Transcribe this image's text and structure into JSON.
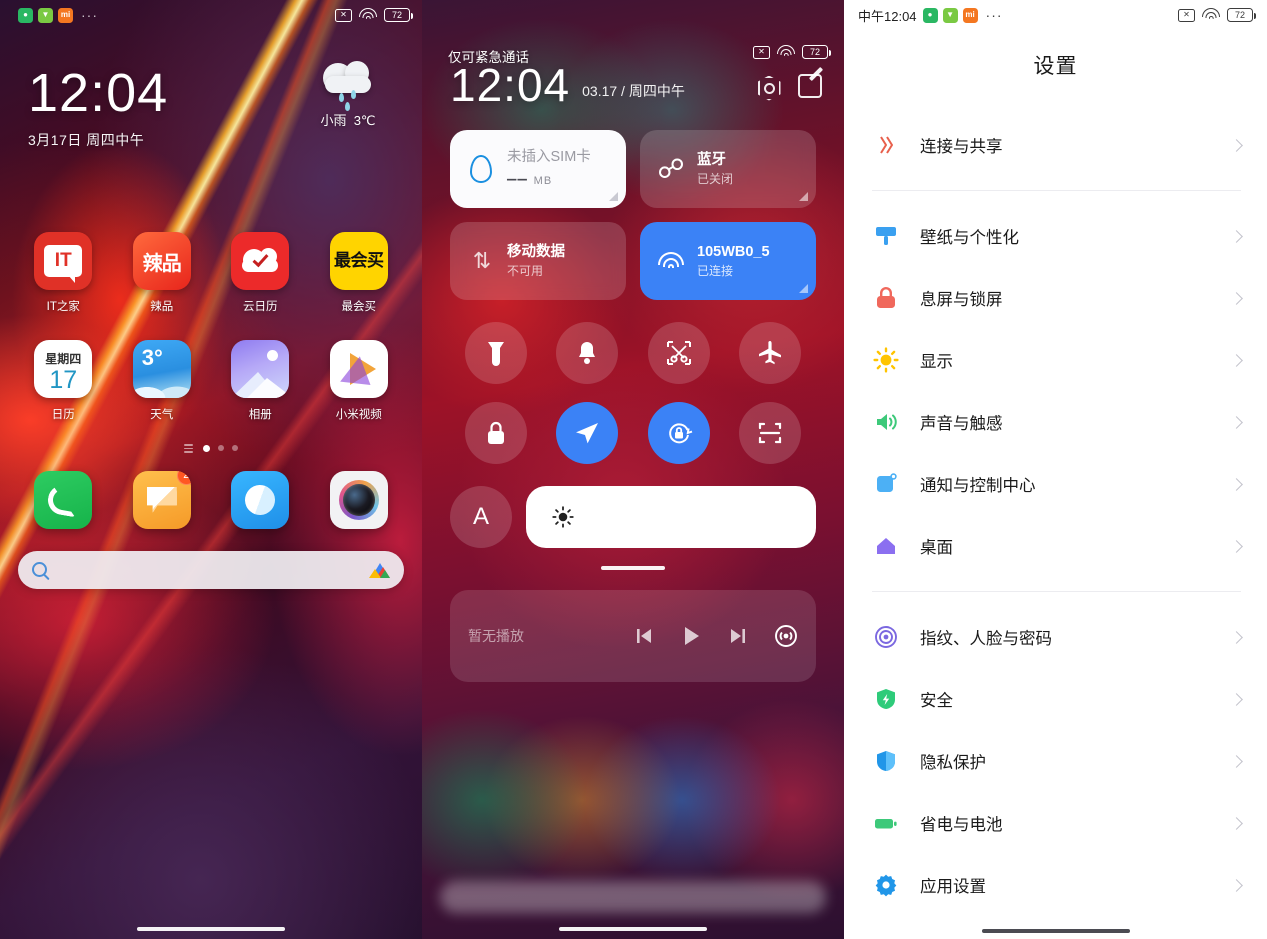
{
  "home": {
    "statusbar": {
      "app_icons": [
        "wechat-mini-icon",
        "alipay-mini-icon",
        "mi-mini-icon"
      ],
      "overflow": "···",
      "sim": "✕",
      "battery": "72"
    },
    "clock": {
      "time": "12:04",
      "date": "3月17日 周四中午"
    },
    "weather": {
      "condition": "小雨",
      "temperature": "3℃",
      "icon": "rain-cloud-icon"
    },
    "apps": [
      {
        "label": "IT之家",
        "icon": "ithome-icon"
      },
      {
        "label": "辣品",
        "icon": "lapin-icon",
        "glyph": "辣品"
      },
      {
        "label": "云日历",
        "icon": "cloud-calendar-icon"
      },
      {
        "label": "最会买",
        "icon": "zuihuimai-icon",
        "glyph_top": "最会买"
      },
      {
        "label": "日历",
        "icon": "calendar-icon",
        "weekday": "星期四",
        "day": "17"
      },
      {
        "label": "天气",
        "icon": "weather-icon",
        "temp": "3°"
      },
      {
        "label": "相册",
        "icon": "gallery-icon"
      },
      {
        "label": "小米视频",
        "icon": "mi-video-icon"
      }
    ],
    "page_dots": {
      "total": 3,
      "active_index": 0
    },
    "dock": [
      {
        "label": "phone",
        "icon": "phone-icon"
      },
      {
        "label": "messages",
        "icon": "message-icon",
        "badge": "2"
      },
      {
        "label": "browser",
        "icon": "browser-icon"
      },
      {
        "label": "camera",
        "icon": "camera-icon"
      }
    ],
    "search": {
      "placeholder": "",
      "icon": "search-icon",
      "lens_icon": "google-lens-icon"
    }
  },
  "control_center": {
    "status_text": "仅可紧急通话",
    "statusbar": {
      "sim": "✕",
      "battery": "72"
    },
    "clock": {
      "time": "12:04",
      "date": "03.17 / 周四中午"
    },
    "header_icons": [
      {
        "name": "settings-hex-icon"
      },
      {
        "name": "edit-icon"
      }
    ],
    "tiles": [
      {
        "title": "未插入SIM卡",
        "subtitle": "‒‒",
        "unit": "MB",
        "icon": "data-drop-icon",
        "state": "light"
      },
      {
        "title": "蓝牙",
        "subtitle": "已关闭",
        "icon": "bluetooth-icon",
        "state": "glass"
      },
      {
        "title": "移动数据",
        "subtitle": "不可用",
        "icon": "mobile-data-icon",
        "state": "glass"
      },
      {
        "title": "105WB0_5",
        "subtitle": "已连接",
        "icon": "wifi-icon",
        "state": "blue"
      }
    ],
    "toggles": [
      {
        "name": "flashlight-icon",
        "active": false
      },
      {
        "name": "bell-icon",
        "active": false
      },
      {
        "name": "screenshot-icon",
        "active": false
      },
      {
        "name": "airplane-mode-icon",
        "active": false
      },
      {
        "name": "lock-icon",
        "active": false
      },
      {
        "name": "location-icon",
        "active": true
      },
      {
        "name": "rotation-lock-icon",
        "active": true
      },
      {
        "name": "scan-icon",
        "active": false
      }
    ],
    "brightness": {
      "auto_label": "A",
      "icon": "sun-icon",
      "level": 0
    },
    "media": {
      "label": "暂无播放",
      "controls": [
        "prev-icon",
        "play-icon",
        "next-icon",
        "cast-icon"
      ]
    }
  },
  "settings": {
    "statusbar": {
      "time": "中午12:04",
      "overflow": "···",
      "sim": "✕",
      "battery": "72"
    },
    "title": "设置",
    "groups": [
      {
        "items": [
          {
            "label": "连接与共享",
            "icon": "connection-share-icon",
            "color": "#e8604c"
          }
        ]
      },
      {
        "items": [
          {
            "label": "壁纸与个性化",
            "icon": "wallpaper-icon",
            "color": "#3aa0f0"
          },
          {
            "label": "息屏与锁屏",
            "icon": "lock-screen-icon",
            "color": "#f0685c"
          },
          {
            "label": "显示",
            "icon": "display-icon",
            "color": "#ffc400"
          },
          {
            "label": "声音与触感",
            "icon": "sound-icon",
            "color": "#3dc97a"
          },
          {
            "label": "通知与控制中心",
            "icon": "notification-icon",
            "color": "#4cb0f5"
          },
          {
            "label": "桌面",
            "icon": "home-screen-icon",
            "color": "#8b6ff0"
          }
        ]
      },
      {
        "items": [
          {
            "label": "指纹、人脸与密码",
            "icon": "fingerprint-icon",
            "color": "#7b68e0"
          },
          {
            "label": "安全",
            "icon": "security-icon",
            "color": "#2ecb7a"
          },
          {
            "label": "隐私保护",
            "icon": "privacy-icon",
            "color": "#2196e8"
          },
          {
            "label": "省电与电池",
            "icon": "battery-icon",
            "color": "#3dc97a"
          },
          {
            "label": "应用设置",
            "icon": "app-settings-icon",
            "color": "#2196e8"
          }
        ]
      }
    ]
  }
}
